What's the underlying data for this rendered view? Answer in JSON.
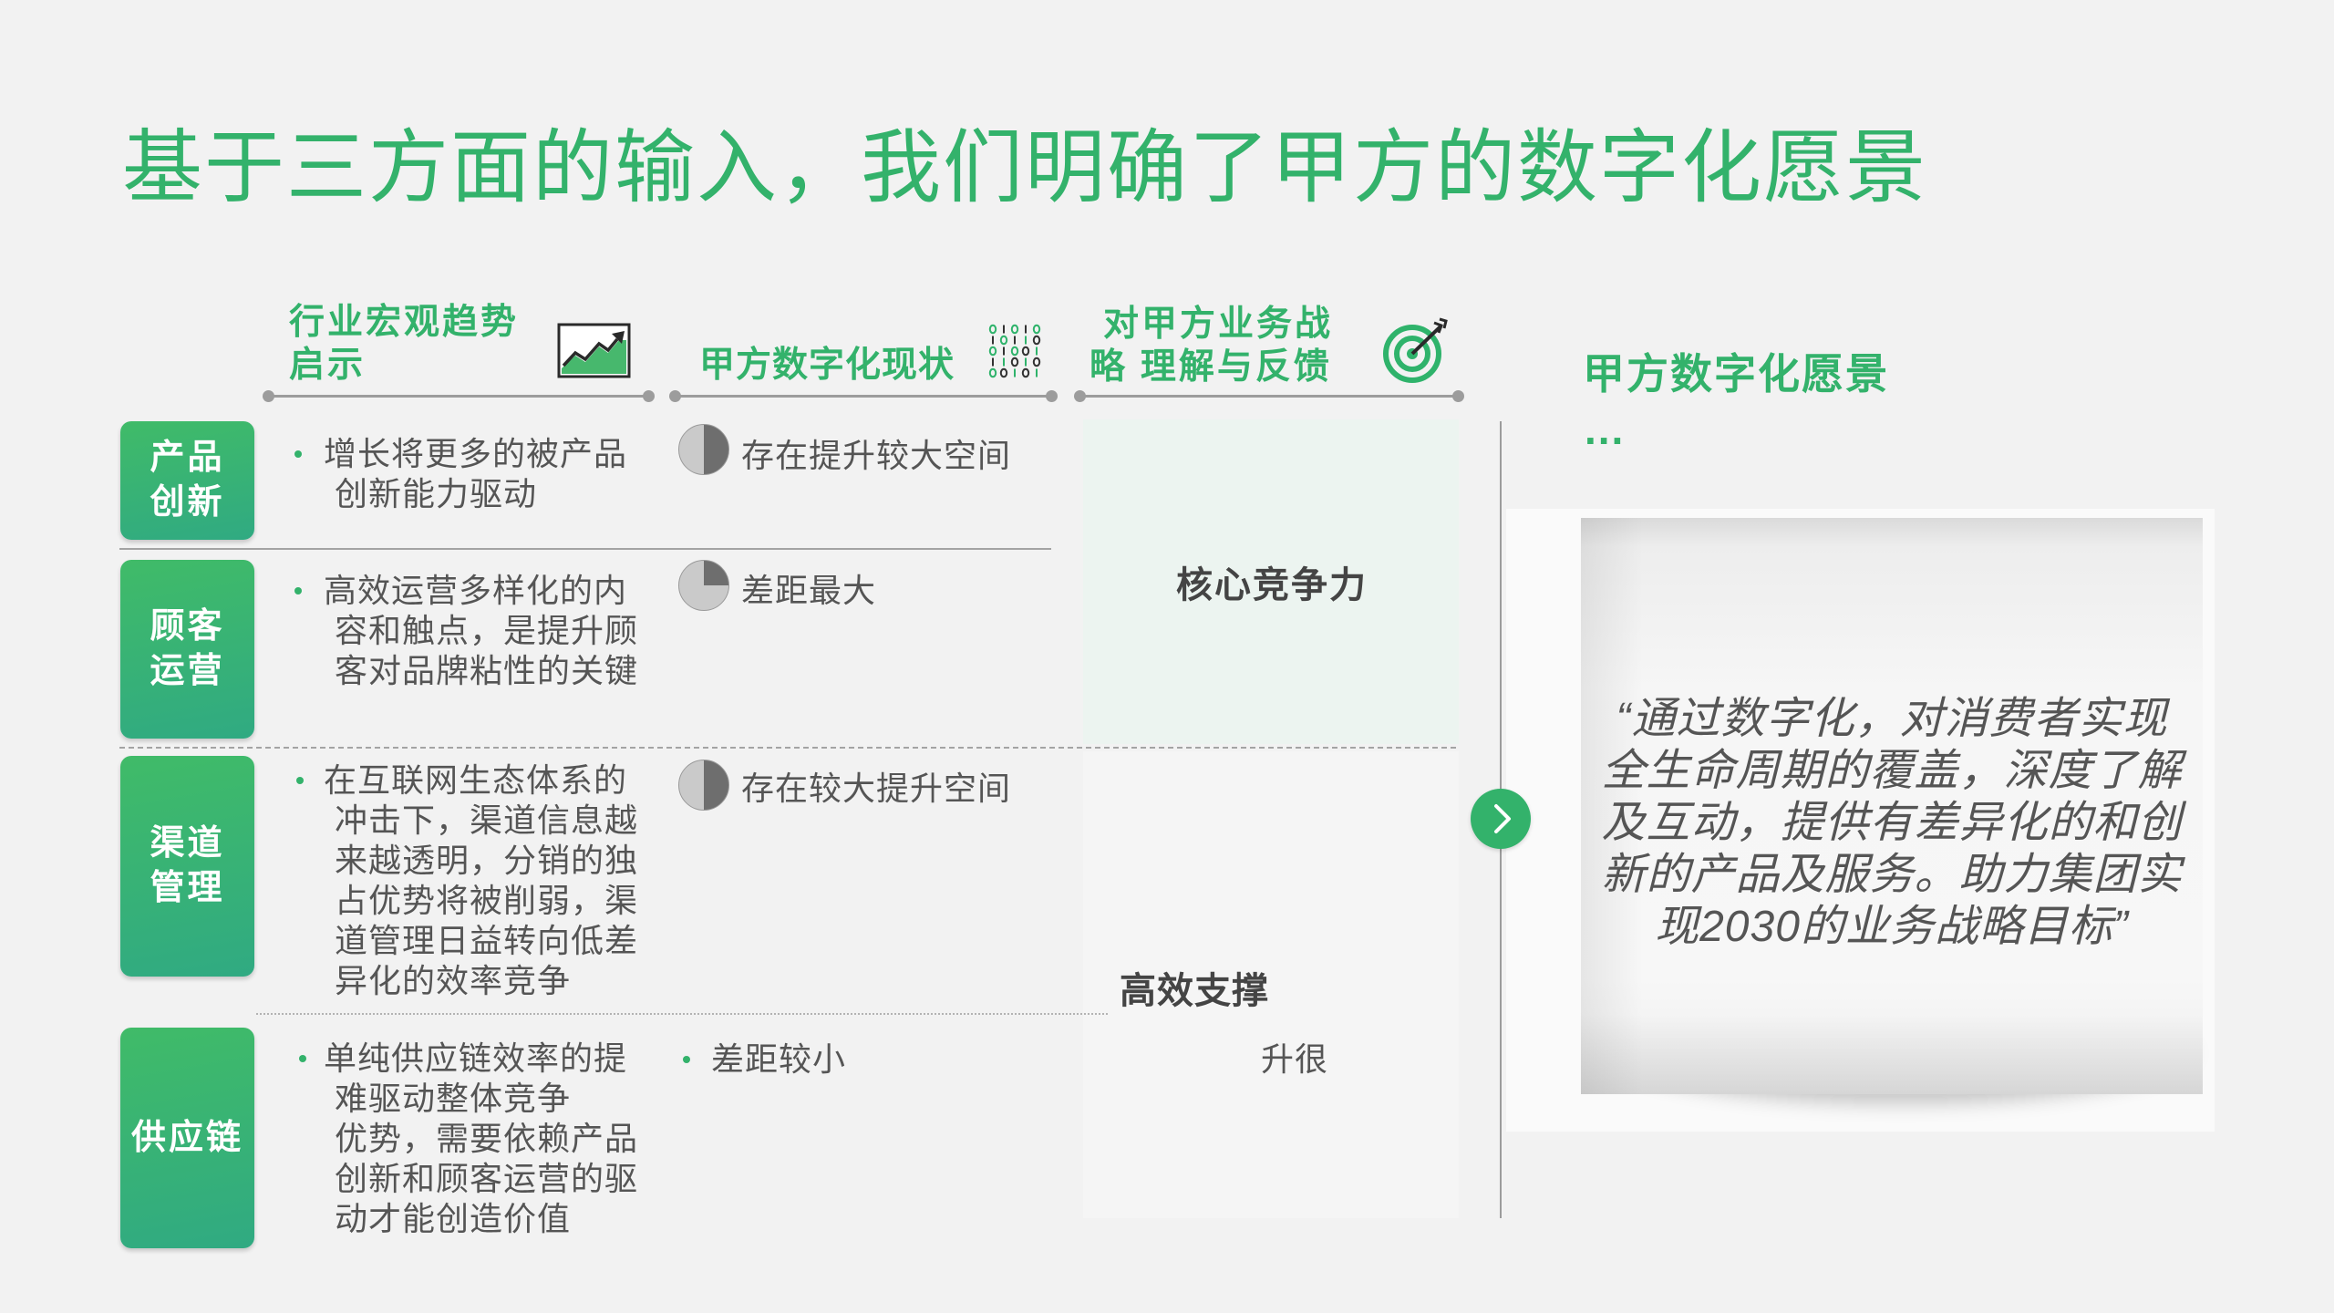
{
  "title": "基于三方面的输入，我们明确了甲方的数字化愿景",
  "columns": {
    "trend": {
      "label": "行业宏观趋势\n启示",
      "icon": "line-chart-icon"
    },
    "status": {
      "label": "甲方数字化现状",
      "icon": "binary-data-icon"
    },
    "feedback": {
      "label": "对甲方业务战\n略 理解与反馈",
      "icon": "target-icon"
    },
    "vision": {
      "label": "甲方数字化愿景",
      "ellipsis": "..."
    }
  },
  "rows": [
    {
      "label": "产品\n创新",
      "trend": "增长将更多的被产品\n创新能力驱动",
      "status": {
        "text": "存在提升较大空间",
        "icon": "harvey-ball-icon",
        "harvey_fill": 0.5
      }
    },
    {
      "label": "顾客\n运营",
      "trend": "高效运营多样化的内\n容和触点，是提升顾\n客对品牌粘性的关键",
      "status": {
        "text": "差距最大",
        "icon": "harvey-ball-icon",
        "harvey_fill": 0.25
      }
    },
    {
      "label": "渠道\n管理",
      "trend": "在互联网生态体系的\n冲击下，渠道信息越\n来越透明，分销的独\n占优势将被削弱，渠\n道管理日益转向低差\n异化的效率竞争",
      "status": {
        "text": "存在较大提升空间",
        "icon": "harvey-ball-icon",
        "harvey_fill": 0.5
      }
    },
    {
      "label": "供应链",
      "trend": "单纯供应链效率的提\n难驱动整体竞争\n优势，需要依赖产品\n创新和顾客运营的驱\n动才能创造价值",
      "status": {
        "text": "差距较小"
      }
    }
  ],
  "feedback": {
    "core": "核心竞争力",
    "support": "高效支撑",
    "fragment": "升很"
  },
  "vision": {
    "arrow_icon": "chevron-right-icon",
    "quote": "“通过数字化，对消费者实现\n全生命周期的覆盖，深度了解\n及互动，提供有差异化的和创\n新的产品及服务。助力集团实\n现2030的业务战略目标”"
  },
  "colors": {
    "accent": "#33b26b",
    "label_gradient_start": "#40bb68",
    "label_gradient_end": "#30aa82",
    "text": "#555555",
    "core_bg": "#ecf4f0"
  }
}
